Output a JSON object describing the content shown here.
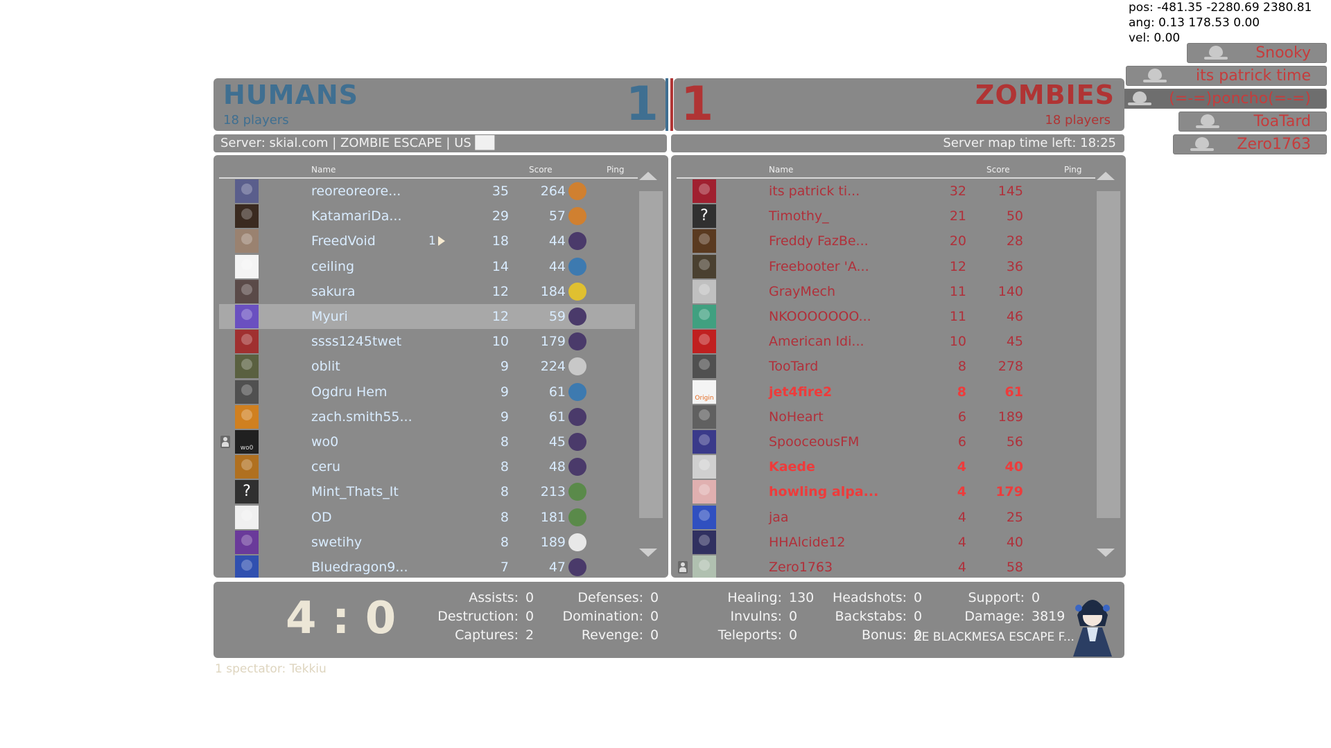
{
  "debug": {
    "pos": "pos:  -481.35 -2280.69 2380.81",
    "ang": "ang:  0.13 178.53 0.00",
    "vel": "vel:  0.00"
  },
  "killfeed": [
    "Snooky",
    "its patrick time",
    "(=-=)poncho(=-=)",
    "ToaTard",
    "Zero1763"
  ],
  "humans": {
    "title": "HUMANS",
    "players": "18 players",
    "score": "1",
    "color": "#3f6f91"
  },
  "zombies": {
    "title": "ZOMBIES",
    "players": "18 players",
    "score": "1",
    "color": "#b03434"
  },
  "server_left": "Server: skial.com | ZOMBIE ESCAPE | US ██",
  "server_right": "Server map time left: 18:25",
  "columns": {
    "name": "Name",
    "score": "Score",
    "ping": "Ping"
  },
  "humans_rows": [
    {
      "name": "reoreoreore...",
      "score": "35",
      "ping": "264",
      "av": "#5a5e8c",
      "cls": "#d08030"
    },
    {
      "name": "KatamariDa...",
      "score": "29",
      "ping": "57",
      "av": "#3a2a20",
      "cls": "#d08030"
    },
    {
      "name": "FreedVoid",
      "score": "18",
      "ping": "44",
      "av": "#9a8270",
      "cls": "#4a3a6a",
      "dom": "1"
    },
    {
      "name": "ceiling",
      "score": "14",
      "ping": "44",
      "av": "#f4f4f4",
      "cls": "#3d7ab0"
    },
    {
      "name": "sakura",
      "score": "12",
      "ping": "184",
      "av": "#5a4a48",
      "cls": "#e0c030"
    },
    {
      "name": "Myuri",
      "score": "12",
      "ping": "59",
      "av": "#6a50c0",
      "cls": "#4a3a6a",
      "sel": true
    },
    {
      "name": "ssss1245twet",
      "score": "10",
      "ping": "179",
      "av": "#a03030",
      "cls": "#4a3a6a"
    },
    {
      "name": "oblit",
      "score": "9",
      "ping": "224",
      "av": "#5a6040",
      "cls": "#c8c8c8"
    },
    {
      "name": "Ogdru Hem",
      "score": "9",
      "ping": "61",
      "av": "#505050",
      "cls": "#3d7ab0"
    },
    {
      "name": "zach.smith55...",
      "score": "9",
      "ping": "61",
      "av": "#d08020",
      "cls": "#4a3a6a"
    },
    {
      "name": "wo0",
      "score": "8",
      "ping": "45",
      "av": "#202020",
      "cls": "#4a3a6a",
      "tag": "wo0",
      "spec": true
    },
    {
      "name": "ceru",
      "score": "8",
      "ping": "48",
      "av": "#b07020",
      "cls": "#4a3a6a"
    },
    {
      "name": "Mint_Thats_It",
      "score": "8",
      "ping": "213",
      "av": "#303030",
      "cls": "#5a8a4a",
      "q": "?"
    },
    {
      "name": "OD",
      "score": "8",
      "ping": "181",
      "av": "#f0f0f0",
      "cls": "#5a8a4a"
    },
    {
      "name": "swetihy",
      "score": "8",
      "ping": "189",
      "av": "#6a3a9a",
      "cls": "#e8e8e8"
    },
    {
      "name": "Bluedragon9...",
      "score": "7",
      "ping": "47",
      "av": "#3050b0",
      "cls": "#4a3a6a"
    }
  ],
  "zombies_rows": [
    {
      "name": "its patrick ti...",
      "score": "32",
      "ping": "145",
      "av": "#a02030"
    },
    {
      "name": "Timothy_",
      "score": "21",
      "ping": "50",
      "av": "#303030",
      "q": "?"
    },
    {
      "name": "Freddy FazBe...",
      "score": "20",
      "ping": "28",
      "av": "#5a3a20"
    },
    {
      "name": "Freebooter 'A...",
      "score": "12",
      "ping": "36",
      "av": "#4a4030"
    },
    {
      "name": "GrayMech",
      "score": "11",
      "ping": "140",
      "av": "#c0c0c0"
    },
    {
      "name": "NKOOOOOOO...",
      "score": "11",
      "ping": "46",
      "av": "#40a080"
    },
    {
      "name": "American Idi...",
      "score": "10",
      "ping": "45",
      "av": "#c02020"
    },
    {
      "name": "TooTard",
      "score": "8",
      "ping": "278",
      "av": "#505050"
    },
    {
      "name": "jet4fire2",
      "score": "8",
      "ping": "61",
      "av": "#f4f4f4",
      "bright": true,
      "tag": "Origin"
    },
    {
      "name": "NoHeart",
      "score": "6",
      "ping": "189",
      "av": "#606060"
    },
    {
      "name": "SpooceousFM",
      "score": "6",
      "ping": "56",
      "av": "#3a3a8a"
    },
    {
      "name": "Kaede",
      "score": "4",
      "ping": "40",
      "av": "#d0d0d0",
      "bright": true
    },
    {
      "name": "howling alpa...",
      "score": "4",
      "ping": "179",
      "av": "#e0b0b0",
      "bright": true
    },
    {
      "name": "jaa",
      "score": "4",
      "ping": "25",
      "av": "#3050c0"
    },
    {
      "name": "HHAlcide12",
      "score": "4",
      "ping": "40",
      "av": "#303060"
    },
    {
      "name": "Zero1763",
      "score": "4",
      "ping": "58",
      "av": "#b0c0b0",
      "spec": true
    }
  ],
  "my_score": "4 : 0",
  "stats": {
    "assists": {
      "label": "Assists:",
      "value": "0"
    },
    "destruction": {
      "label": "Destruction:",
      "value": "0"
    },
    "captures": {
      "label": "Captures:",
      "value": "2"
    },
    "defenses": {
      "label": "Defenses:",
      "value": "0"
    },
    "domination": {
      "label": "Domination:",
      "value": "0"
    },
    "revenge": {
      "label": "Revenge:",
      "value": "0"
    },
    "healing": {
      "label": "Healing:",
      "value": "130"
    },
    "invulns": {
      "label": "Invulns:",
      "value": "0"
    },
    "teleports": {
      "label": "Teleports:",
      "value": "0"
    },
    "headshots": {
      "label": "Headshots:",
      "value": "0"
    },
    "backstabs": {
      "label": "Backstabs:",
      "value": "0"
    },
    "bonus": {
      "label": "Bonus:",
      "value": "0"
    },
    "support": {
      "label": "Support:",
      "value": "0"
    },
    "damage": {
      "label": "Damage:",
      "value": "3819"
    }
  },
  "map_name": "ZE BLACKMESA ESCAPE F...",
  "spectators": "1 spectator: Tekkiu",
  "colors": {
    "panel": "#888888",
    "human_text": "#d9ecff",
    "zombie_text": "#b0303a",
    "zombie_bright": "#ee3b3b"
  }
}
